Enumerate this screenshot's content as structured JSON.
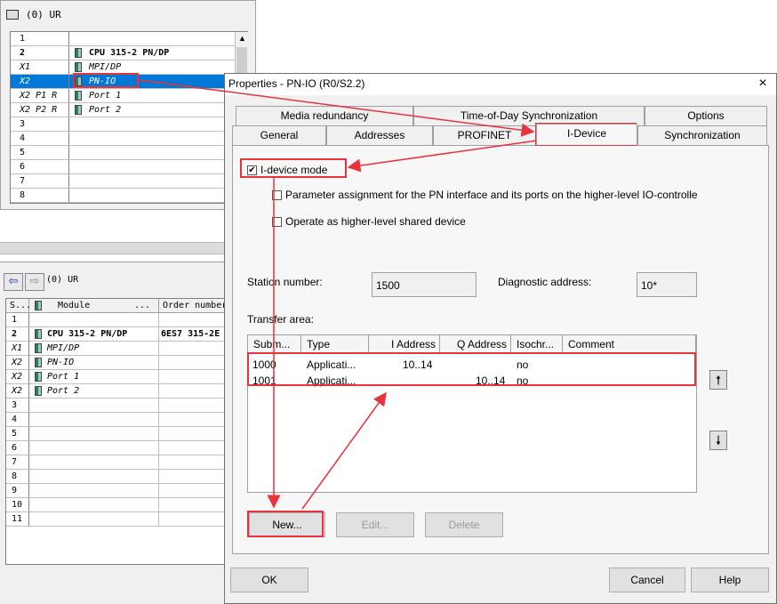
{
  "rack": {
    "title": "(0)  UR",
    "rows": [
      {
        "slot": "1",
        "module": "",
        "style": "plain",
        "icon": false
      },
      {
        "slot": "2",
        "module": "CPU 315-2 PN/DP",
        "style": "bold",
        "icon": true
      },
      {
        "slot": "X1",
        "module": "MPI/DP",
        "style": "normal",
        "icon": true
      },
      {
        "slot": "X2",
        "module": "PN-IO",
        "style": "selected",
        "icon": true
      },
      {
        "slot": "X2 P1 R",
        "module": "Port 1",
        "style": "normal",
        "icon": true
      },
      {
        "slot": "X2 P2 R",
        "module": "Port 2",
        "style": "normal",
        "icon": true
      },
      {
        "slot": "3",
        "module": "",
        "style": "plain",
        "icon": false
      },
      {
        "slot": "4",
        "module": "",
        "style": "plain",
        "icon": false
      },
      {
        "slot": "5",
        "module": "",
        "style": "plain",
        "icon": false
      },
      {
        "slot": "6",
        "module": "",
        "style": "plain",
        "icon": false
      },
      {
        "slot": "7",
        "module": "",
        "style": "plain",
        "icon": false
      },
      {
        "slot": "8",
        "module": "",
        "style": "plain",
        "icon": false
      }
    ]
  },
  "detail": {
    "title": "(0)    UR",
    "headers": {
      "slot": "S...",
      "module": "Module",
      "module_more": "...",
      "order": "Order number"
    },
    "rows": [
      {
        "slot": "1",
        "module": "",
        "order": "",
        "style": "plain",
        "icon": false
      },
      {
        "slot": "2",
        "module": "CPU 315-2 PN/DP",
        "order": "6ES7 315-2E",
        "style": "bold",
        "icon": true
      },
      {
        "slot": "X1",
        "module": "MPI/DP",
        "order": "",
        "style": "normal",
        "icon": true
      },
      {
        "slot": "X2",
        "module": "PN-IO",
        "order": "",
        "style": "normal",
        "icon": true
      },
      {
        "slot": "X2",
        "module": "Port 1",
        "order": "",
        "style": "normal",
        "icon": true
      },
      {
        "slot": "X2",
        "module": "Port 2",
        "order": "",
        "style": "normal",
        "icon": true
      },
      {
        "slot": "3",
        "module": "",
        "order": "",
        "style": "plain",
        "icon": false
      },
      {
        "slot": "4",
        "module": "",
        "order": "",
        "style": "plain",
        "icon": false
      },
      {
        "slot": "5",
        "module": "",
        "order": "",
        "style": "plain",
        "icon": false
      },
      {
        "slot": "6",
        "module": "",
        "order": "",
        "style": "plain",
        "icon": false
      },
      {
        "slot": "7",
        "module": "",
        "order": "",
        "style": "plain",
        "icon": false
      },
      {
        "slot": "8",
        "module": "",
        "order": "",
        "style": "plain",
        "icon": false
      },
      {
        "slot": "9",
        "module": "",
        "order": "",
        "style": "plain",
        "icon": false
      },
      {
        "slot": "10",
        "module": "",
        "order": "",
        "style": "plain",
        "icon": false
      },
      {
        "slot": "11",
        "module": "",
        "order": "",
        "style": "plain",
        "icon": false
      }
    ]
  },
  "dialog": {
    "title": "Properties - PN-IO (R0/S2.2)",
    "close": "×",
    "tabs_back": [
      "Media redundancy",
      "Time-of-Day Synchronization",
      "Options"
    ],
    "tabs_front": [
      "General",
      "Addresses",
      "PROFINET",
      "I-Device",
      "Synchronization"
    ],
    "active_tab": "I-Device",
    "idevice_mode": {
      "label": "I-device mode",
      "checked": true
    },
    "param_assign": {
      "label": "Parameter assignment for the PN interface and its ports on the higher-level IO-controlle",
      "checked": false
    },
    "shared_device": {
      "label": "Operate as higher-level shared device",
      "checked": false
    },
    "station_number_label": "Station number:",
    "station_number_value": "1500",
    "diag_address_label": "Diagnostic address:",
    "diag_address_value": "10*",
    "transfer_area_label": "Transfer area:",
    "table_headers": [
      "Subm...",
      "Type",
      "I Address",
      "Q Address",
      "Isochr...",
      "Comment"
    ],
    "table_rows": [
      {
        "subm": "1000",
        "type": "Applicati...",
        "i_addr": "10..14",
        "q_addr": "",
        "isochr": "no",
        "comment": ""
      },
      {
        "subm": "1001",
        "type": "Applicati...",
        "i_addr": "",
        "q_addr": "10..14",
        "isochr": "no",
        "comment": ""
      }
    ],
    "buttons": {
      "new": "New...",
      "edit": "Edit...",
      "delete": "Delete",
      "ok": "OK",
      "cancel": "Cancel",
      "help": "Help"
    },
    "arrow_up": "🠕",
    "arrow_down": "🠗"
  },
  "colors": {
    "highlight": "#e8323c",
    "selection": "#0078d7"
  }
}
